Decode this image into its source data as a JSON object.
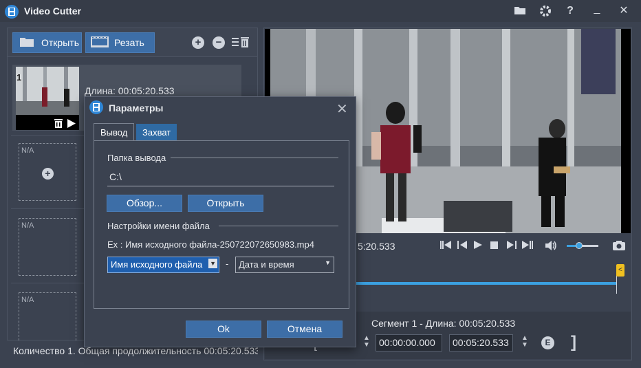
{
  "app": {
    "title": "Video Cutter"
  },
  "titlebar": {
    "folder_icon": "folder-icon",
    "settings_icon": "gear-icon",
    "help_label": "?",
    "minimize_label": "_",
    "close_label": "✕"
  },
  "toolbar": {
    "open_label": "Открыть",
    "cut_label": "Резать",
    "add_icon": "plus-icon",
    "remove_icon": "minus-icon",
    "clear_icon": "list-trash-icon"
  },
  "clips": [
    {
      "index": "1",
      "duration": "Длина: 00:05:20.533"
    },
    {
      "placeholder": "N/A"
    },
    {
      "placeholder": "N/A"
    },
    {
      "placeholder": "N/A"
    }
  ],
  "status": {
    "text": "Количество 1. Общая продолжительность 00:05:20.533"
  },
  "player": {
    "current_time": "5:20.533",
    "volume_fraction": 0.4
  },
  "segment": {
    "title": "Сегмент 1 - Длина: 00:05:20.533",
    "start": "00:00:00.000",
    "end": "00:05:20.533",
    "end_badge": "E",
    "bracket_close": "]"
  },
  "dialog": {
    "title": "Параметры",
    "tabs": [
      {
        "label": "Вывод",
        "active": true
      },
      {
        "label": "Захват",
        "active": false
      }
    ],
    "output_folder_label": "Папка вывода",
    "output_folder_value": "C:\\",
    "browse_label": "Обзор...",
    "open_label": "Открыть",
    "filename_settings_label": "Настройки имени файла",
    "example_text": "Ex : Имя исходного файла-250722072650983.mp4",
    "name_part1": "Имя исходного файла",
    "separator": "-",
    "name_part2": "Дата и время",
    "ok_label": "Ok",
    "cancel_label": "Отмена"
  },
  "colors": {
    "background": "#3b4250",
    "accent": "#3d6ea7",
    "timeline": "#3ba0e0",
    "marker": "#f0c020"
  }
}
